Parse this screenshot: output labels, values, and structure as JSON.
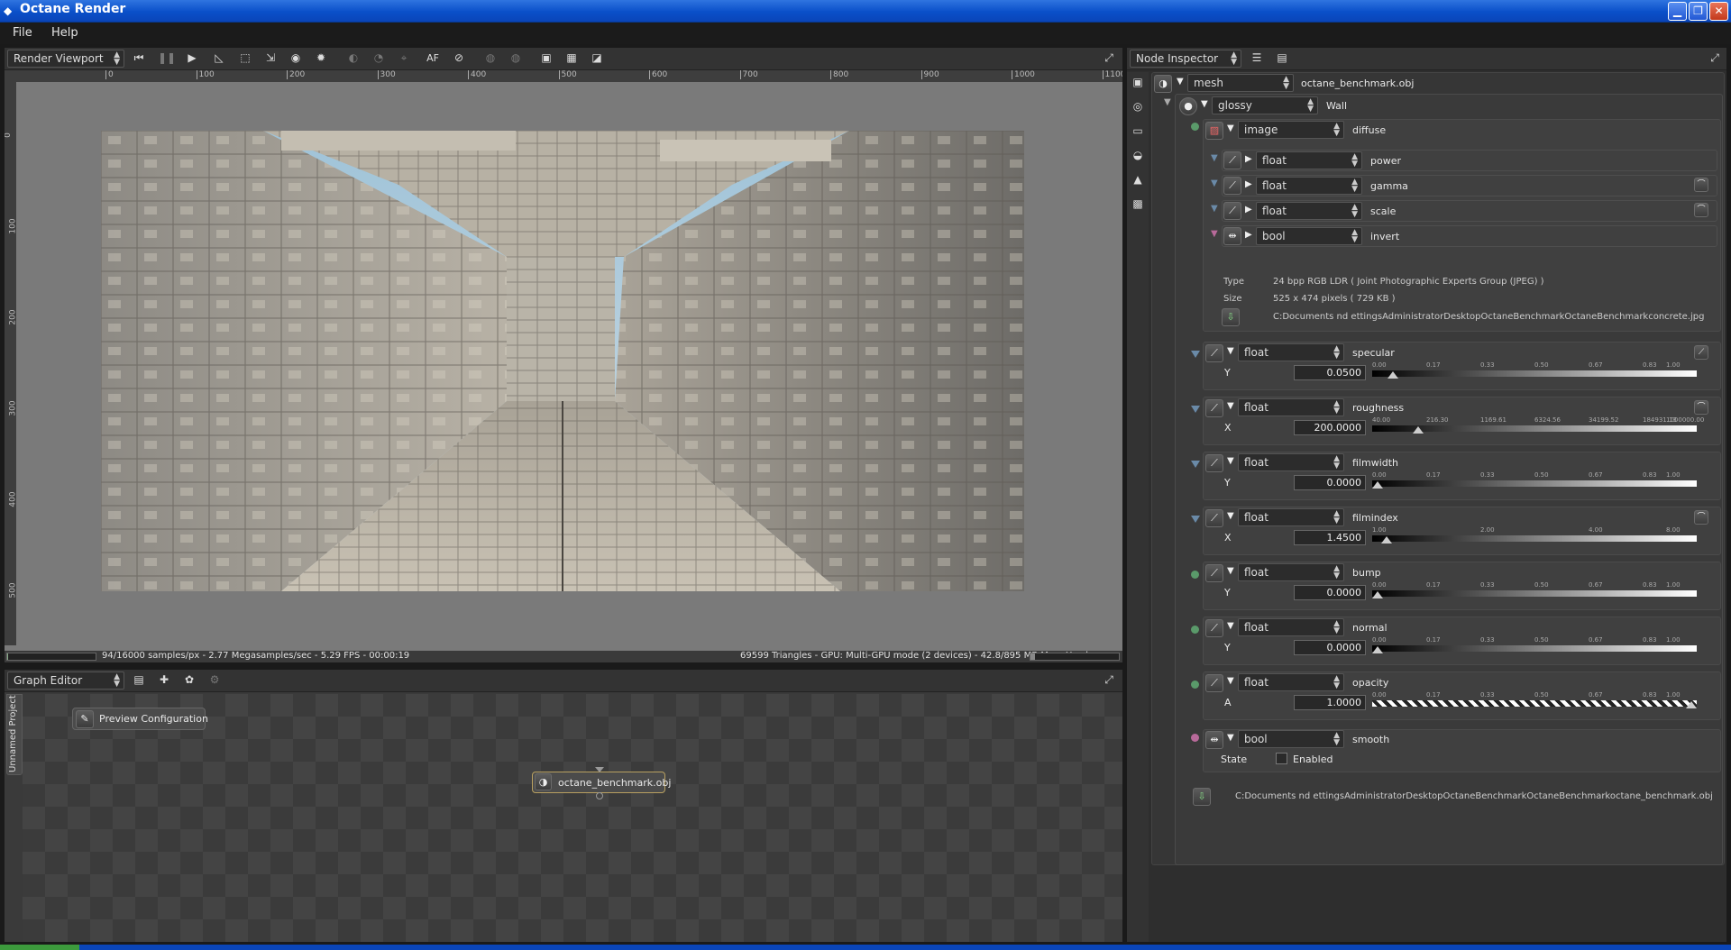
{
  "window": {
    "title": "Octane Render"
  },
  "menu": {
    "file": "File",
    "help": "Help"
  },
  "viewport": {
    "combo": "Render Viewport",
    "ruler_x": [
      "0",
      "100",
      "200",
      "300",
      "400",
      "500",
      "600",
      "700",
      "800",
      "900",
      "1000",
      "1100"
    ],
    "ruler_y": [
      "0",
      "100",
      "200",
      "300",
      "400",
      "500"
    ],
    "toolbar_af": "AF",
    "status_left": "94/16000 samples/px - 2.77 Megasamples/sec - 5.29 FPS - 00:00:19",
    "status_right": "69599 Triangles - GPU: Multi-GPU mode (2 devices) - 42.8/895 MB Mem Used",
    "render_alt": "concrete corridor render"
  },
  "graph": {
    "combo": "Graph Editor",
    "side_tab": "Unnamed Project",
    "preview_config": "Preview Configuration",
    "node_label": "octane_benchmark.obj"
  },
  "inspector": {
    "combo": "Node Inspector",
    "mesh": {
      "type": "mesh",
      "name": "octane_benchmark.obj"
    },
    "glossy": {
      "type": "glossy",
      "name": "Wall"
    },
    "image": {
      "type": "image",
      "name": "diffuse"
    },
    "image_params": [
      {
        "type": "float",
        "name": "power"
      },
      {
        "type": "float",
        "name": "gamma"
      },
      {
        "type": "float",
        "name": "scale"
      },
      {
        "type": "bool",
        "name": "invert"
      }
    ],
    "image_info": {
      "type_label": "Type",
      "type_value": "24 bpp RGB LDR ( Joint Photographic Experts Group (JPEG) )",
      "size_label": "Size",
      "size_value": "525 x 474 pixels ( 729 KB )",
      "path": "C:Documents  nd  ettingsAdministratorDesktopOctaneBenchmarkOctaneBenchmarkconcrete.jpg"
    },
    "params": [
      {
        "type": "float",
        "name": "specular",
        "axis": "Y",
        "value": "0.0500",
        "ticks": [
          "0.00",
          "0.17",
          "0.33",
          "0.50",
          "0.67",
          "0.83",
          "1.00"
        ],
        "level": 0.05
      },
      {
        "type": "float",
        "name": "roughness",
        "axis": "X",
        "value": "200.0000",
        "ticks": [
          "40.00",
          "216.30",
          "1169.61",
          "6324.56",
          "34199.52",
          "184931.13",
          "1000000.00"
        ],
        "level": 0.13
      },
      {
        "type": "float",
        "name": "filmwidth",
        "axis": "Y",
        "value": "0.0000",
        "ticks": [
          "0.00",
          "0.17",
          "0.33",
          "0.50",
          "0.67",
          "0.83",
          "1.00"
        ],
        "level": 0
      },
      {
        "type": "float",
        "name": "filmindex",
        "axis": "X",
        "value": "1.4500",
        "ticks": [
          "1.00",
          "",
          "2.00",
          "",
          "4.00",
          "",
          "8.00"
        ],
        "level": 0.03
      },
      {
        "type": "float",
        "name": "bump",
        "axis": "Y",
        "value": "0.0000",
        "ticks": [
          "0.00",
          "0.17",
          "0.33",
          "0.50",
          "0.67",
          "0.83",
          "1.00"
        ],
        "level": 0
      },
      {
        "type": "float",
        "name": "normal",
        "axis": "Y",
        "value": "0.0000",
        "ticks": [
          "0.00",
          "0.17",
          "0.33",
          "0.50",
          "0.67",
          "0.83",
          "1.00"
        ],
        "level": 0
      },
      {
        "type": "float",
        "name": "opacity",
        "axis": "A",
        "value": "1.0000",
        "ticks": [
          "0.00",
          "0.17",
          "0.33",
          "0.50",
          "0.67",
          "0.83",
          "1.00"
        ],
        "level": 1
      }
    ],
    "smooth": {
      "type": "bool",
      "name": "smooth",
      "state_label": "State",
      "check_label": "Enabled"
    },
    "mesh_path": "C:Documents  nd  ettingsAdministratorDesktopOctaneBenchmarkOctaneBenchmarkoctane_benchmark.obj"
  },
  "colors": {
    "accent": "#0a4fc9",
    "dot_green": "#5a9a6a",
    "dot_blue": "#6a8aa8",
    "dot_pink": "#b86a9a"
  }
}
